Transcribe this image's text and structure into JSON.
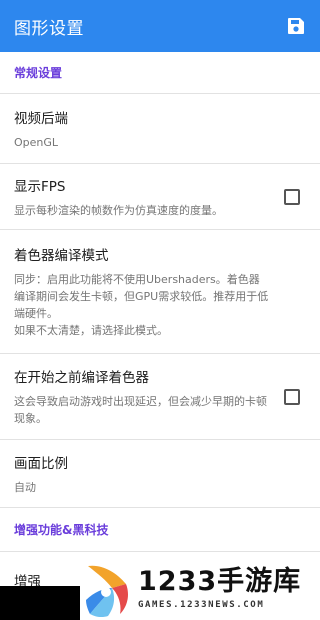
{
  "appbar": {
    "title": "图形设置",
    "save_icon": "save-icon"
  },
  "sections": {
    "general": "常规设置",
    "enhancements": "增强功能&黑科技"
  },
  "prefs": {
    "video_backend": {
      "title": "视频后端",
      "summary": "OpenGL"
    },
    "show_fps": {
      "title": "显示FPS",
      "summary": "显示每秒渲染的帧数作为仿真速度的度量。",
      "checked": false
    },
    "shader_mode": {
      "title": "着色器编译模式",
      "summary": "同步：启用此功能将不使用Ubershaders。着色器编译期间会发生卡顿，但GPU需求较低。推荐用于低端硬件。\n如果不太清楚，请选择此模式。"
    },
    "precompile": {
      "title": "在开始之前编译着色器",
      "summary": "这会导致启动游戏时出现延迟，但会减少早期的卡顿现象。",
      "checked": false
    },
    "aspect_ratio": {
      "title": "画面比例",
      "summary": "自动"
    },
    "enhance": {
      "title": "增强"
    }
  },
  "watermark": {
    "brand": "1233手游库",
    "domain": "GAMES.1233NEWS.COM"
  },
  "colors": {
    "appbar": "#2d87ee",
    "section_header": "#6a3ddb"
  }
}
